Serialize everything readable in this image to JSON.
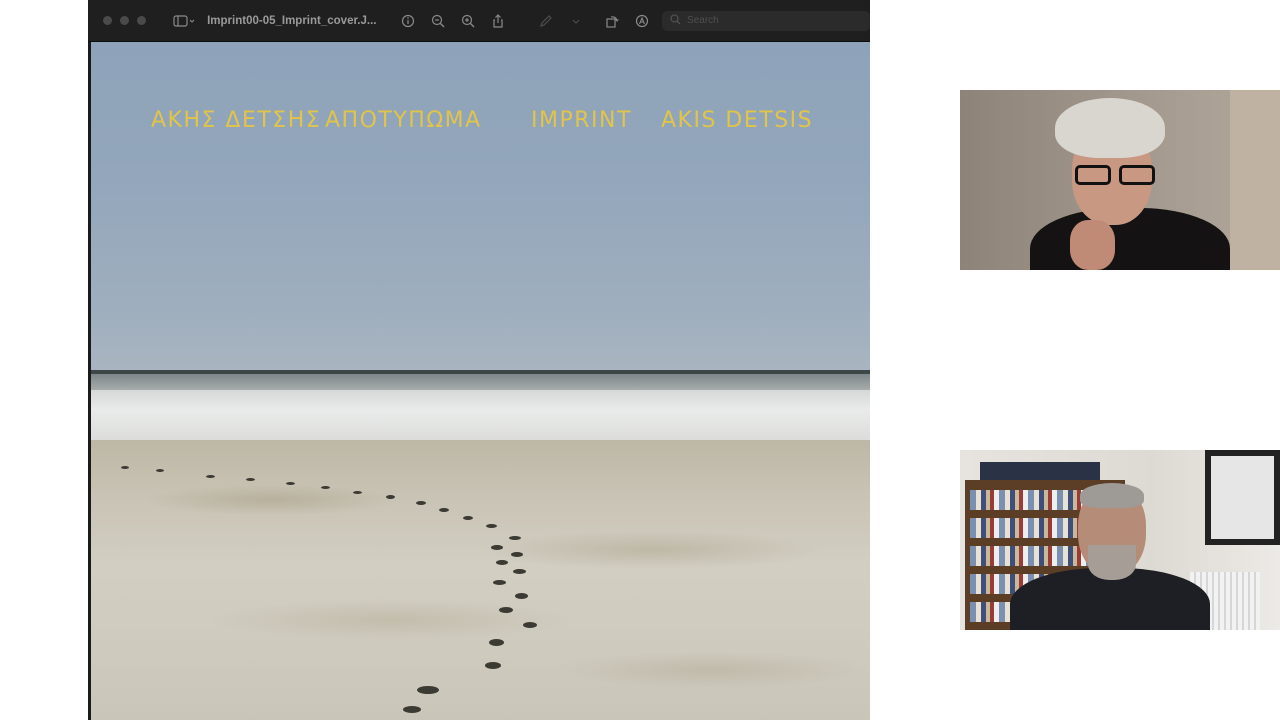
{
  "window": {
    "title": "Imprint00-05_Imprint_cover.J...",
    "search_placeholder": "Search"
  },
  "cover": {
    "greek_author": "ΑΚΗΣ ΔΕΤΣΗΣ",
    "greek_title": "ΑΠΟΤΥΠΩΜΑ",
    "english_title": "IMPRINT",
    "english_author": "AKIS DETSIS",
    "title_color": "#e2c548"
  },
  "icons": {
    "sidebar": "sidebar-icon",
    "info": "info-icon",
    "zoom_out": "zoom-out-icon",
    "zoom_in": "zoom-in-icon",
    "share": "share-icon",
    "markup": "markup-icon",
    "rotate": "rotate-icon",
    "annotate": "annotate-icon",
    "search": "search-icon"
  }
}
